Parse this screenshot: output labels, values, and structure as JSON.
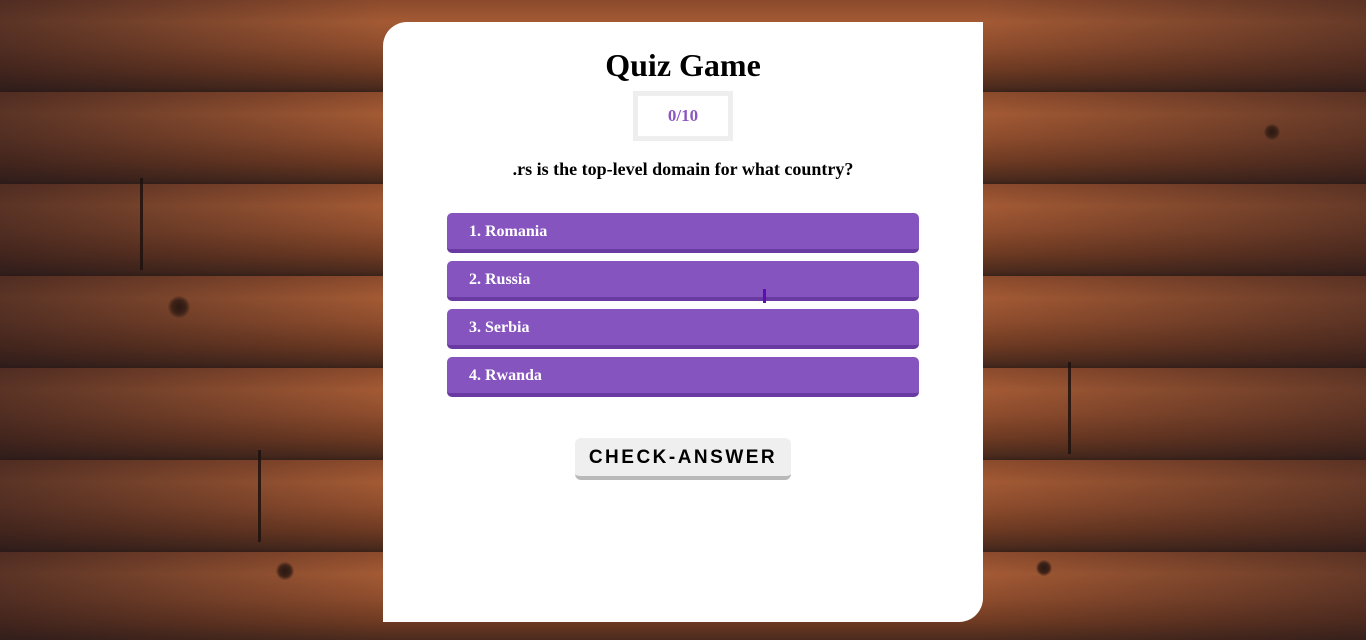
{
  "quiz": {
    "title": "Quiz Game",
    "score": "0/10",
    "question": ".rs is the top-level domain for what country?",
    "options": [
      {
        "label": "1. Romania"
      },
      {
        "label": "2. Russia"
      },
      {
        "label": "3. Serbia"
      },
      {
        "label": "4. Rwanda"
      }
    ],
    "check_button_label": "CHECK-ANSWER"
  },
  "colors": {
    "accent": "#8654bf",
    "score_text": "#8a55c0",
    "card": "#ffffff"
  }
}
